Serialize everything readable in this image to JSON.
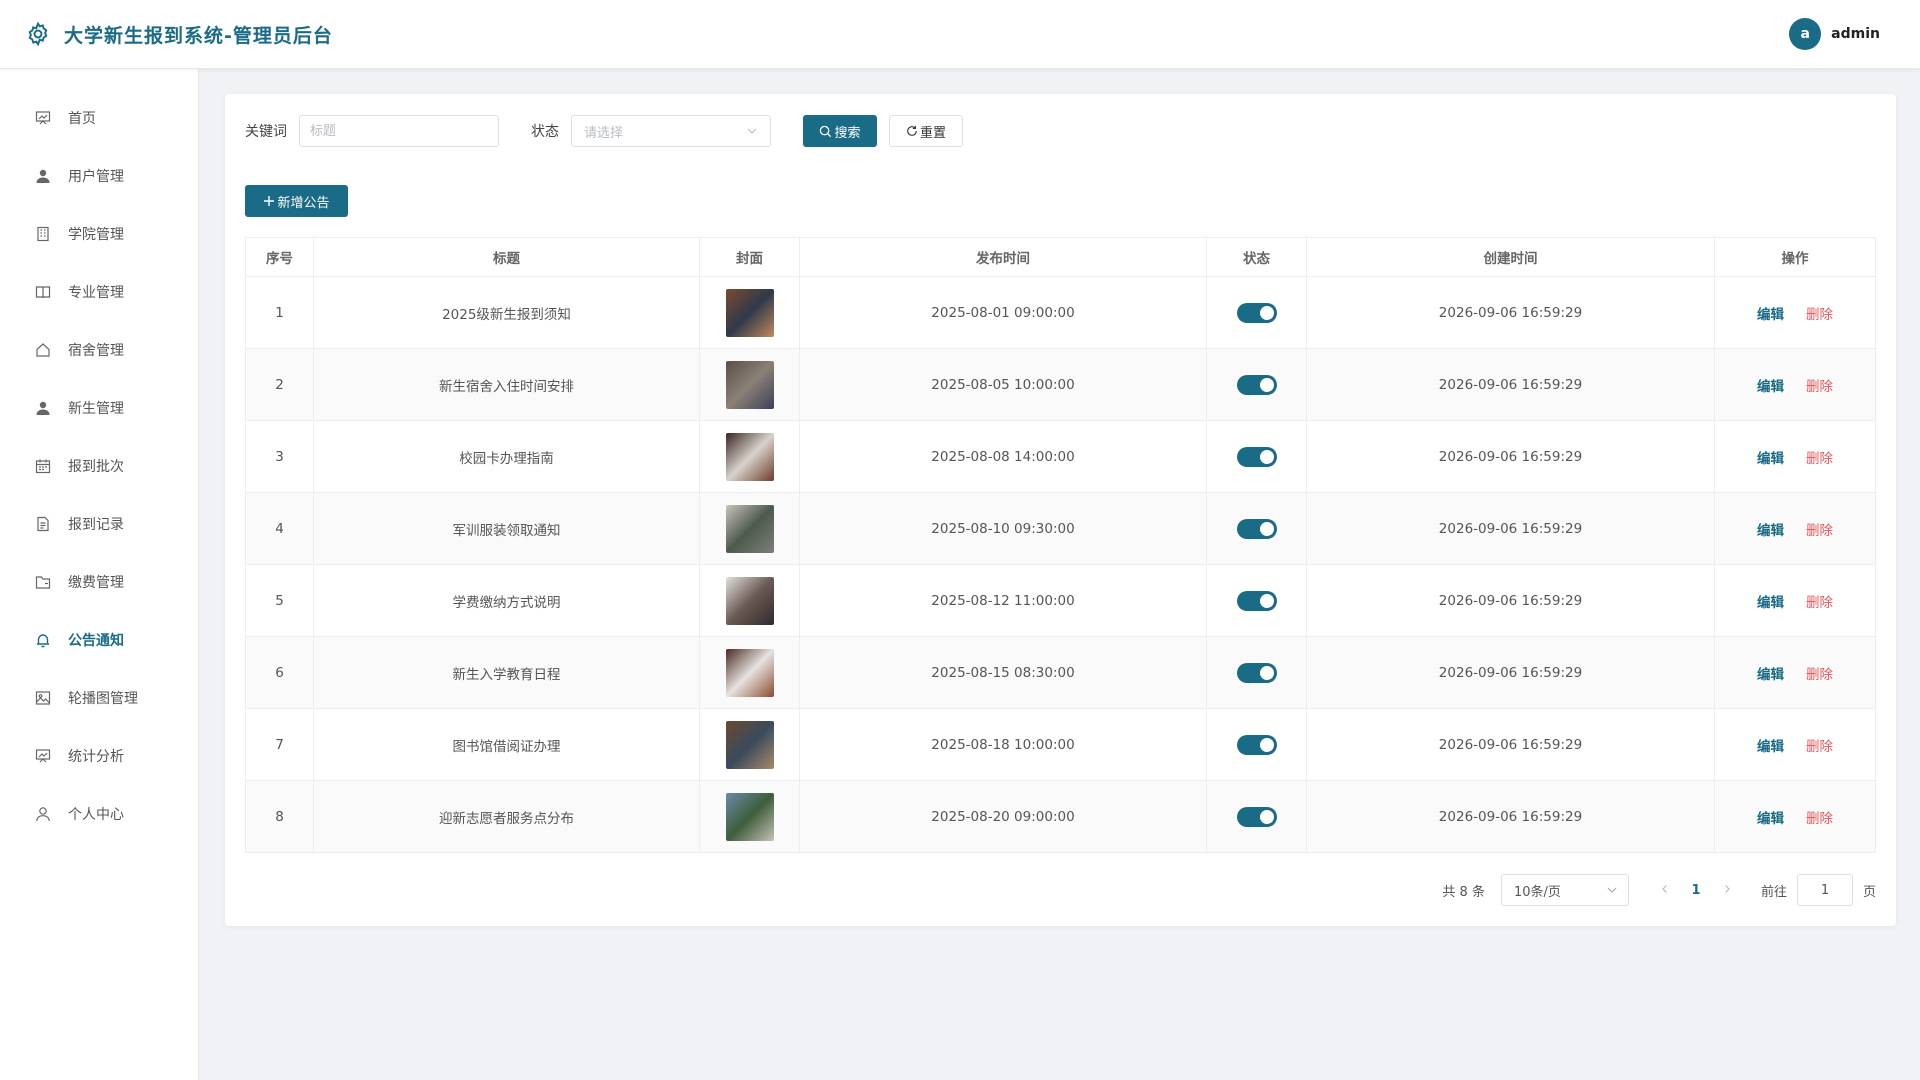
{
  "header": {
    "title": "大学新生报到系统-管理员后台",
    "avatar_letter": "a",
    "username": "admin"
  },
  "sidebar": {
    "items": [
      {
        "label": "首页",
        "icon": "chart-board-icon",
        "active": false
      },
      {
        "label": "用户管理",
        "icon": "user-icon",
        "active": false
      },
      {
        "label": "学院管理",
        "icon": "building-icon",
        "active": false
      },
      {
        "label": "专业管理",
        "icon": "book-icon",
        "active": false
      },
      {
        "label": "宿舍管理",
        "icon": "house-icon",
        "active": false
      },
      {
        "label": "新生管理",
        "icon": "user-icon",
        "active": false
      },
      {
        "label": "报到批次",
        "icon": "calendar-icon",
        "active": false
      },
      {
        "label": "报到记录",
        "icon": "document-icon",
        "active": false
      },
      {
        "label": "缴费管理",
        "icon": "folder-icon",
        "active": false
      },
      {
        "label": "公告通知",
        "icon": "bell-icon",
        "active": true
      },
      {
        "label": "轮播图管理",
        "icon": "picture-icon",
        "active": false
      },
      {
        "label": "统计分析",
        "icon": "chart-board-icon",
        "active": false
      },
      {
        "label": "个人中心",
        "icon": "user-outline-icon",
        "active": false
      }
    ]
  },
  "filters": {
    "keyword_label": "关键词",
    "keyword_placeholder": "标题",
    "keyword_value": "",
    "status_label": "状态",
    "status_placeholder": "请选择",
    "search_label": "搜索",
    "reset_label": "重置"
  },
  "toolbar": {
    "add_label": "新增公告"
  },
  "table": {
    "columns": [
      "序号",
      "标题",
      "封面",
      "发布时间",
      "状态",
      "创建时间",
      "操作"
    ],
    "edit_label": "编辑",
    "delete_label": "删除",
    "rows": [
      {
        "index": "1",
        "title": "2025级新生报到须知",
        "publish_time": "2025-08-01 09:00:00",
        "status_on": true,
        "created_time": "2026-09-06 16:59:29",
        "cover_colors": [
          "#7a4a2e",
          "#2f3a4a",
          "#c28a5a"
        ]
      },
      {
        "index": "2",
        "title": "新生宿舍入住时间安排",
        "publish_time": "2025-08-05 10:00:00",
        "status_on": true,
        "created_time": "2026-09-06 16:59:29",
        "cover_colors": [
          "#5b4f4a",
          "#8a8076",
          "#3b3f58"
        ]
      },
      {
        "index": "3",
        "title": "校园卡办理指南",
        "publish_time": "2025-08-08 14:00:00",
        "status_on": true,
        "created_time": "2026-09-06 16:59:29",
        "cover_colors": [
          "#3a2420",
          "#d8d2cc",
          "#6d3b2a"
        ]
      },
      {
        "index": "4",
        "title": "军训服装领取通知",
        "publish_time": "2025-08-10 09:30:00",
        "status_on": true,
        "created_time": "2026-09-06 16:59:29",
        "cover_colors": [
          "#c9c4bf",
          "#4e5a4e",
          "#7d7f7a"
        ]
      },
      {
        "index": "5",
        "title": "学费缴纳方式说明",
        "publish_time": "2025-08-12 11:00:00",
        "status_on": true,
        "created_time": "2026-09-06 16:59:29",
        "cover_colors": [
          "#e2e0dc",
          "#6a5a54",
          "#2e2a2c"
        ]
      },
      {
        "index": "6",
        "title": "新生入学教育日程",
        "publish_time": "2025-08-15 08:30:00",
        "status_on": true,
        "created_time": "2026-09-06 16:59:29",
        "cover_colors": [
          "#4a2a22",
          "#e6e3df",
          "#8a4a32"
        ]
      },
      {
        "index": "7",
        "title": "图书馆借阅证办理",
        "publish_time": "2025-08-18 10:00:00",
        "status_on": true,
        "created_time": "2026-09-06 16:59:29",
        "cover_colors": [
          "#6a4a30",
          "#3a4a5c",
          "#a88a6a"
        ]
      },
      {
        "index": "8",
        "title": "迎新志愿者服务点分布",
        "publish_time": "2025-08-20 09:00:00",
        "status_on": true,
        "created_time": "2026-09-06 16:59:29",
        "cover_colors": [
          "#6a8aaa",
          "#3e5e3a",
          "#c8c0b8"
        ]
      }
    ]
  },
  "pagination": {
    "total_label": "共 8 条",
    "page_size_label": "10条/页",
    "current_page": "1",
    "goto_label": "前往",
    "goto_value": "1",
    "page_unit": "页"
  },
  "colors": {
    "accent": "#1a6b86",
    "danger": "#e8595a"
  }
}
